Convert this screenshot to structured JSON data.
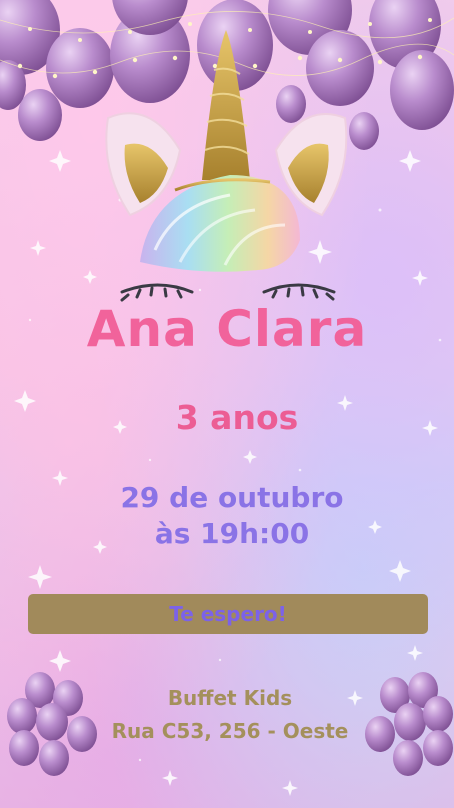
{
  "invitation": {
    "name": "Ana Clara",
    "age": "3 anos",
    "date_line": "29 de outubro",
    "time_line": "às 19h:00",
    "banner_text": "Te espero!",
    "venue_name": "Buffet Kids",
    "venue_address": "Rua C53, 256 - Oeste"
  },
  "colors": {
    "name": "#f1639b",
    "age": "#ec5d94",
    "date": "#8a73e6",
    "banner_bg": "#a18a5b",
    "banner_text": "#7c62e8",
    "venue": "#a4905c",
    "balloon": "#b385c8"
  },
  "icons": [
    "balloon-icon",
    "unicorn-horn-icon",
    "unicorn-ear-icon",
    "unicorn-mane-icon",
    "closed-eye-icon",
    "star-icon",
    "fairy-lights-icon"
  ]
}
